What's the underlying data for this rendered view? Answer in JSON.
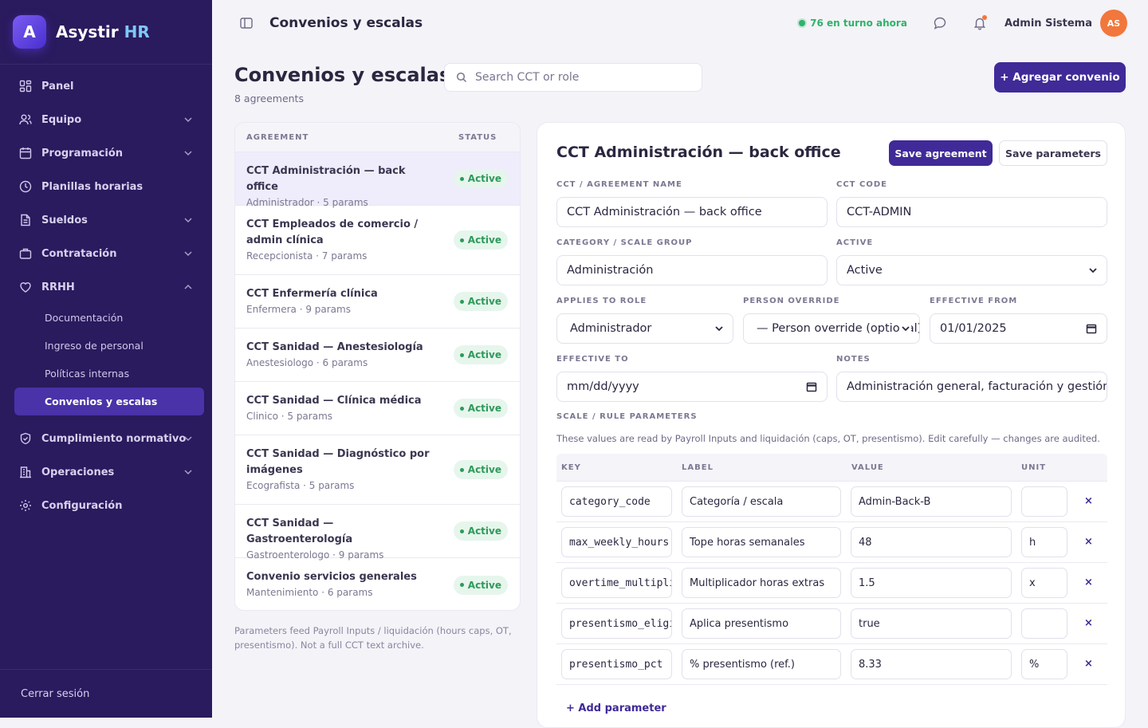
{
  "brand": {
    "letter": "A",
    "name": "Asystir",
    "suffix": "HR"
  },
  "nav": {
    "panel": "Panel",
    "equipo": "Equipo",
    "programacion": "Programación",
    "planillas": "Planillas horarias",
    "sueldos": "Sueldos",
    "contratacion": "Contratación",
    "rrhh": "RRHH",
    "sub": {
      "documentacion": "Documentación",
      "ingreso": "Ingreso de personal",
      "politicas": "Políticas internas",
      "convenios": "Convenios y escalas"
    },
    "cumplimiento": "Cumplimiento normativo",
    "operaciones": "Operaciones",
    "configuracion": "Configuración",
    "logout": "Cerrar sesión"
  },
  "topbar": {
    "title": "Convenios y escalas",
    "online": "76 en turno ahora",
    "user": "Admin Sistema",
    "initials": "AS"
  },
  "page": {
    "title": "Convenios y escalas",
    "count": "8 agreements",
    "search_placeholder": "Search CCT or role",
    "add_button": "+ Agregar convenio"
  },
  "list": {
    "col_agreement": "AGREEMENT",
    "col_status": "STATUS",
    "items": [
      {
        "title": "CCT Administración — back office",
        "meta": "Administrador · 5 params",
        "status": "Active"
      },
      {
        "title": "CCT Empleados de comercio / admin clínica",
        "meta": "Recepcionista · 7 params",
        "status": "Active"
      },
      {
        "title": "CCT Enfermería clínica",
        "meta": "Enfermera · 9 params",
        "status": "Active"
      },
      {
        "title": "CCT Sanidad — Anestesiología",
        "meta": "Anestesiologo · 6 params",
        "status": "Active"
      },
      {
        "title": "CCT Sanidad — Clínica médica",
        "meta": "Clinico · 5 params",
        "status": "Active"
      },
      {
        "title": "CCT Sanidad — Diagnóstico por imágenes",
        "meta": "Ecografista · 5 params",
        "status": "Active"
      },
      {
        "title": "CCT Sanidad — Gastroenterología",
        "meta": "Gastroenterologo · 9 params",
        "status": "Active"
      },
      {
        "title": "Convenio servicios generales",
        "meta": "Mantenimiento · 6 params",
        "status": "Active"
      }
    ],
    "footnote": "Parameters feed Payroll Inputs / liquidación (hours caps, OT, presentismo). Not a full CCT text archive."
  },
  "detail": {
    "title": "CCT Administración — back office",
    "save_agreement": "Save agreement",
    "save_parameters": "Save parameters",
    "labels": {
      "name": "CCT / AGREEMENT NAME",
      "code": "CCT CODE",
      "category": "CATEGORY / SCALE GROUP",
      "active": "ACTIVE",
      "role": "APPLIES TO ROLE",
      "override": "PERSON OVERRIDE",
      "from": "EFFECTIVE FROM",
      "to": "EFFECTIVE TO",
      "notes": "NOTES",
      "params": "SCALE / RULE PARAMETERS"
    },
    "values": {
      "name": "CCT Administración — back office",
      "code": "CCT-ADMIN",
      "category": "Administración",
      "active": "Active",
      "role": "Administrador",
      "override": "— Person override (optional)",
      "from": "01/01/2025",
      "to": "mm/dd/yyyy",
      "notes": "Administración general, facturación y gestión"
    },
    "help": "These values are read by Payroll Inputs and liquidación (caps, OT, presentismo). Edit carefully — changes are audited.",
    "cols": {
      "key": "KEY",
      "label": "LABEL",
      "value": "VALUE",
      "unit": "UNIT"
    },
    "params": [
      {
        "key": "category_code",
        "label": "Categoría / escala",
        "value": "Admin-Back-B",
        "unit": ""
      },
      {
        "key": "max_weekly_hours",
        "label": "Tope horas semanales",
        "value": "48",
        "unit": "h"
      },
      {
        "key": "overtime_multiplier",
        "label": "Multiplicador horas extras",
        "value": "1.5",
        "unit": "x"
      },
      {
        "key": "presentismo_eligible",
        "label": "Aplica presentismo",
        "value": "true",
        "unit": ""
      },
      {
        "key": "presentismo_pct",
        "label": "% presentismo (ref.)",
        "value": "8.33",
        "unit": "%"
      }
    ],
    "delete": "×",
    "add_param": "+ Add parameter"
  }
}
